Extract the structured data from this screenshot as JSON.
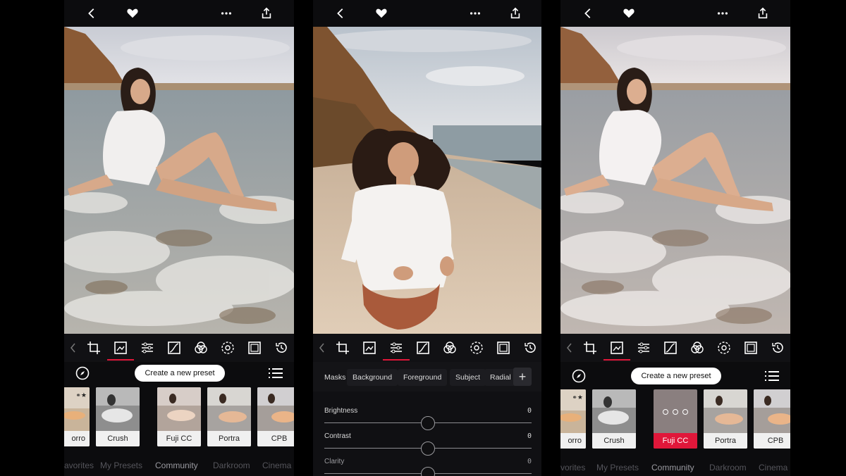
{
  "icons": {
    "back": "chevron-left-icon",
    "favorite": "heart-icon",
    "more": "more-dots-icon",
    "share": "share-icon",
    "tools": [
      "chevron-left-icon",
      "crop-icon",
      "presets-icon",
      "adjust-sliders-icon",
      "curves-icon",
      "color-mix-icon",
      "effects-icon",
      "frame-icon",
      "history-icon"
    ]
  },
  "panel1": {
    "create_preset": "Create a new preset",
    "presets": [
      {
        "label": "orro",
        "badge": "⚭★"
      },
      {
        "label": "Crush"
      },
      {
        "label": "Fuji CC"
      },
      {
        "label": "Portra"
      },
      {
        "label": "CPB"
      }
    ],
    "tabs": [
      "avorites",
      "My Presets",
      "Community",
      "Darkroom",
      "Cinema"
    ],
    "active_tab": "Community"
  },
  "panel2": {
    "masks_label": "Masks",
    "masks": [
      "Background",
      "Foreground",
      "Subject",
      "Radial"
    ],
    "add_label": "+",
    "sliders": [
      {
        "name": "Brightness",
        "value": "0",
        "level": 0.5
      },
      {
        "name": "Contrast",
        "value": "0",
        "level": 0.5
      },
      {
        "name": "Clarity",
        "value": "0",
        "level": 0.5
      }
    ]
  },
  "panel3": {
    "create_preset": "Create a new preset",
    "presets": [
      {
        "label": "orro",
        "badge": "⚭★"
      },
      {
        "label": "Crush"
      },
      {
        "label": "Fuji CC",
        "selected": true
      },
      {
        "label": "Portra"
      },
      {
        "label": "CPB"
      }
    ],
    "tabs": [
      "vorites",
      "My Presets",
      "Community",
      "Darkroom",
      "Cinema"
    ],
    "active_tab": "Community"
  },
  "colors": {
    "accent": "#e0173a",
    "background": "#0c0c0e",
    "pill": "#ffffff"
  }
}
